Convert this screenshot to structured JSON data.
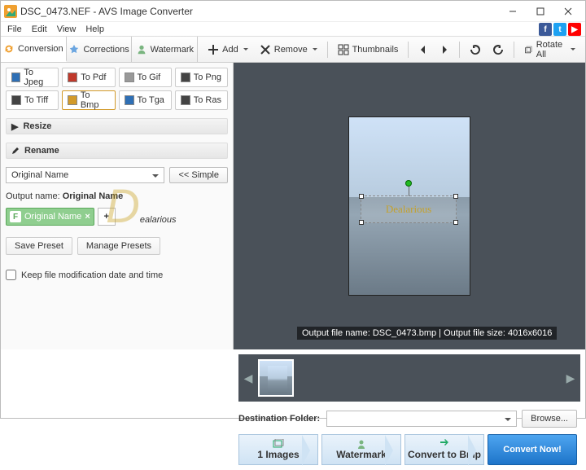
{
  "title": "DSC_0473.NEF - AVS Image Converter",
  "menu": {
    "file": "File",
    "edit": "Edit",
    "view": "View",
    "help": "Help"
  },
  "tabs": {
    "conversion": "Conversion",
    "corrections": "Corrections",
    "watermark": "Watermark"
  },
  "toolbar": {
    "add": "Add",
    "remove": "Remove",
    "thumbnails": "Thumbnails",
    "rotate_all": "Rotate All"
  },
  "formats": [
    {
      "label": "To Jpeg",
      "color": "#2e6fb5"
    },
    {
      "label": "To Pdf",
      "color": "#c0392b"
    },
    {
      "label": "To Gif",
      "color": "#999"
    },
    {
      "label": "To Png",
      "color": "#444"
    },
    {
      "label": "To Tiff",
      "color": "#444"
    },
    {
      "label": "To Bmp",
      "color": "#d29a2a"
    },
    {
      "label": "To Tga",
      "color": "#2e6fb5"
    },
    {
      "label": "To Ras",
      "color": "#444"
    }
  ],
  "sections": {
    "resize": "Resize",
    "rename": "Rename"
  },
  "rename": {
    "select_value": "Original Name",
    "simple_btn": "<< Simple",
    "output_label": "Output name:",
    "output_bold": "Original Name",
    "tag_text": "Original Name",
    "save_preset": "Save Preset",
    "manage_presets": "Manage Presets"
  },
  "keep_date": "Keep file modification date and time",
  "preview": {
    "wm_text": "Dealarious",
    "info_name_label": "Output file name: ",
    "info_name": "DSC_0473.bmp",
    "info_size_label": "Output file size: ",
    "info_size": "4016x6016"
  },
  "bg_wm_d": "D",
  "bg_wm_rest": "ealarious",
  "dest": {
    "label": "Destination Folder:",
    "browse": "Browse..."
  },
  "steps": {
    "images_icon": "",
    "images": "1 Images",
    "watermark": "Watermark",
    "convert": "Convert to Bmp",
    "now": "Convert Now!"
  }
}
